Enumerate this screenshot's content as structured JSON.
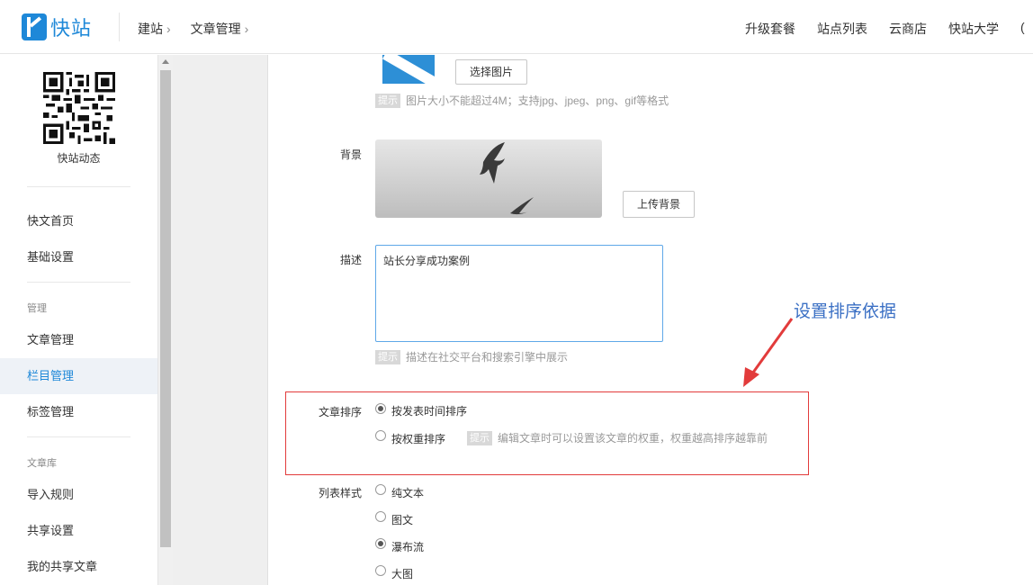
{
  "header": {
    "logo_text": "快站",
    "breadcrumbs": [
      {
        "label": "建站"
      },
      {
        "label": "文章管理"
      }
    ],
    "chevron": "›",
    "nav": [
      "升级套餐",
      "站点列表",
      "云商店",
      "快站大学"
    ],
    "nav_overflow": "("
  },
  "sidebar": {
    "qr_caption": "快站动态",
    "items": [
      {
        "label": "快文首页"
      },
      {
        "label": "基础设置"
      }
    ],
    "group_manage": "管理",
    "manage_items": [
      {
        "label": "文章管理"
      },
      {
        "label": "栏目管理",
        "active": true
      },
      {
        "label": "标签管理"
      }
    ],
    "group_library": "文章库",
    "library_items": [
      {
        "label": "导入规则"
      },
      {
        "label": "共享设置"
      },
      {
        "label": "我的共享文章"
      }
    ]
  },
  "form": {
    "choose_image_button": "选择图片",
    "tip_tag": "提示",
    "image_tip": "图片大小不能超过4M；支持jpg、jpeg、png、gif等格式",
    "background_label": "背景",
    "upload_background_button": "上传背景",
    "description_label": "描述",
    "description_value": "站长分享成功案例",
    "description_tip": "描述在社交平台和搜索引擎中展示",
    "sort_label": "文章排序",
    "sort_options": [
      {
        "label": "按发表时间排序",
        "checked": true
      },
      {
        "label": "按权重排序",
        "checked": false
      }
    ],
    "sort_tip": "编辑文章时可以设置该文章的权重，权重越高排序越靠前",
    "list_style_label": "列表样式",
    "list_style_options": [
      {
        "label": "纯文本",
        "checked": false
      },
      {
        "label": "图文",
        "checked": false
      },
      {
        "label": "瀑布流",
        "checked": true
      },
      {
        "label": "大图",
        "checked": false
      }
    ]
  },
  "annotation": {
    "text": "设置排序依据",
    "color": "#3a6fc4",
    "box_color": "#e23b3b"
  }
}
